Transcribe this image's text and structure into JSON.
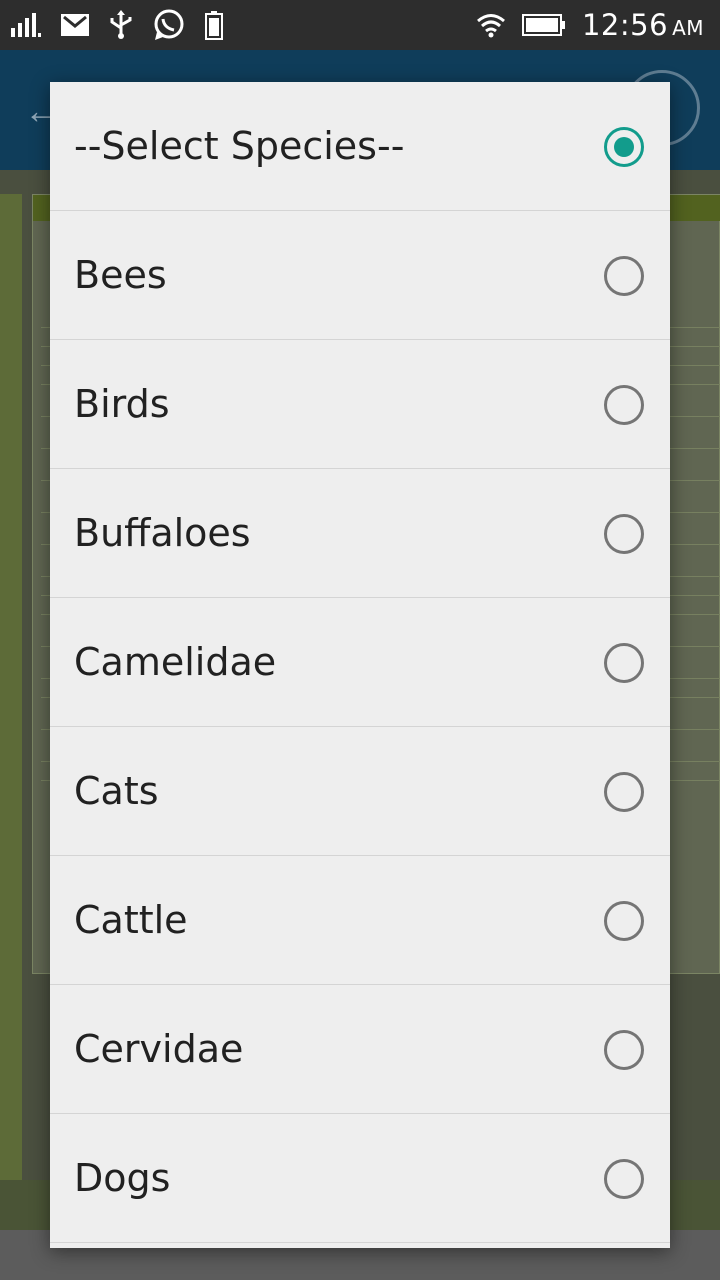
{
  "status_bar": {
    "time": "12:56",
    "ampm": "AM",
    "icons": [
      "signal-icon",
      "gmail-icon",
      "usb-icon",
      "whatsapp-icon",
      "battery-saver-icon",
      "wifi-icon",
      "battery-icon"
    ]
  },
  "dialog": {
    "options": [
      {
        "label": "--Select Species--",
        "selected": true
      },
      {
        "label": "Bees",
        "selected": false
      },
      {
        "label": "Birds",
        "selected": false
      },
      {
        "label": "Buffaloes",
        "selected": false
      },
      {
        "label": "Camelidae",
        "selected": false
      },
      {
        "label": "Cats",
        "selected": false
      },
      {
        "label": "Cattle",
        "selected": false
      },
      {
        "label": "Cervidae",
        "selected": false
      },
      {
        "label": "Dogs",
        "selected": false
      }
    ]
  },
  "colors": {
    "accent": "#129c8c",
    "toolbar": "#0f3d5a",
    "dialog_bg": "#eeeeee"
  }
}
